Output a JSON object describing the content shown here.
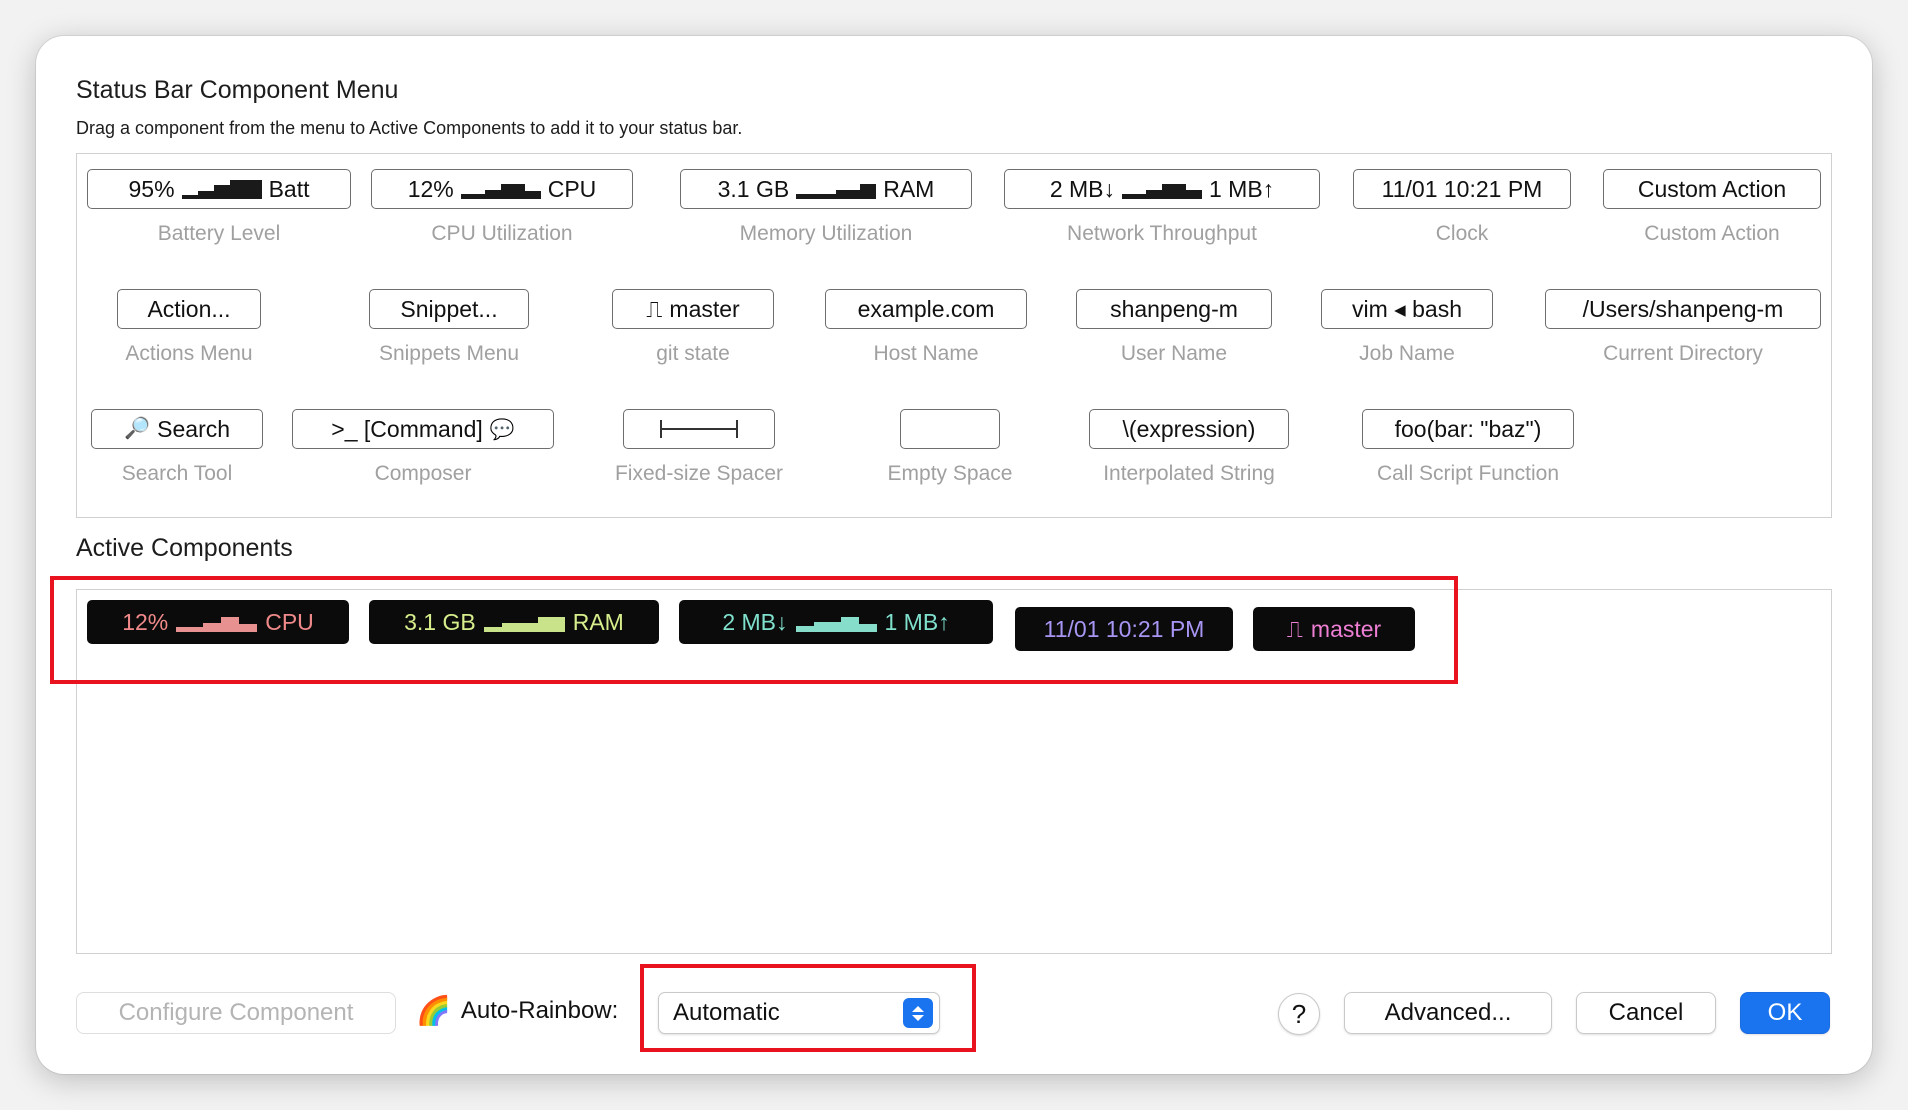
{
  "menu": {
    "title": "Status Bar Component Menu",
    "subtitle": "Drag a component from the menu to Active Components to add it to your status bar.",
    "components": [
      {
        "chip_left": "95%",
        "chip_right": "Batt",
        "label": "Battery Level"
      },
      {
        "chip_left": "12%",
        "chip_right": "CPU",
        "label": "CPU Utilization"
      },
      {
        "chip_left": "3.1 GB",
        "chip_right": "RAM",
        "label": "Memory Utilization"
      },
      {
        "chip_left": "2 MB↓",
        "chip_right": "1 MB↑",
        "label": "Network Throughput"
      },
      {
        "chip": "11/01 10:21 PM",
        "label": "Clock"
      },
      {
        "chip": "Custom Action",
        "label": "Custom Action"
      },
      {
        "chip": "Action...",
        "label": "Actions Menu"
      },
      {
        "chip": "Snippet...",
        "label": "Snippets Menu"
      },
      {
        "chip_icon": "⎍",
        "chip": "master",
        "label": "git state"
      },
      {
        "chip": "example.com",
        "label": "Host Name"
      },
      {
        "chip": "shanpeng-m",
        "label": "User Name"
      },
      {
        "chip": "vim ◂ bash",
        "label": "Job Name"
      },
      {
        "chip": "/Users/shanpeng-m",
        "label": "Current Directory"
      },
      {
        "chip_icon": "🔎",
        "chip": "Search",
        "label": "Search Tool"
      },
      {
        "chip": ">_ [Command]",
        "chip_icon": "💬",
        "label": "Composer"
      },
      {
        "chip": "",
        "label": "Fixed-size Spacer"
      },
      {
        "chip": "",
        "label": "Empty Space"
      },
      {
        "chip": "\\(expression)",
        "label": "Interpolated String"
      },
      {
        "chip": "foo(bar: \"baz\")",
        "label": "Call Script Function"
      }
    ]
  },
  "active": {
    "title": "Active Components",
    "chips": [
      {
        "left": "12%",
        "right": "CPU",
        "color": "#f08a8a",
        "bar_color": "#e79191"
      },
      {
        "left": "3.1 GB",
        "right": "RAM",
        "color": "#d7ee8c",
        "bar_color": "#c8e38a"
      },
      {
        "left": "2 MB↓",
        "right": "1 MB↑",
        "color": "#7fe0cc",
        "bar_color": "#86ddc9"
      },
      {
        "text": "11/01 10:21 PM",
        "color": "#a996f4"
      },
      {
        "icon": "⎍",
        "text": "master",
        "color": "#ee7fd4"
      }
    ]
  },
  "footer": {
    "configure_label": "Configure Component",
    "rainbow_icon": "🌈",
    "rainbow_label": "Auto-Rainbow:",
    "rainbow_value": "Automatic",
    "help_label": "?",
    "advanced_label": "Advanced...",
    "cancel_label": "Cancel",
    "ok_label": "OK"
  },
  "colors": {
    "accent": "#1a74f0",
    "highlight": "#e8131e"
  }
}
